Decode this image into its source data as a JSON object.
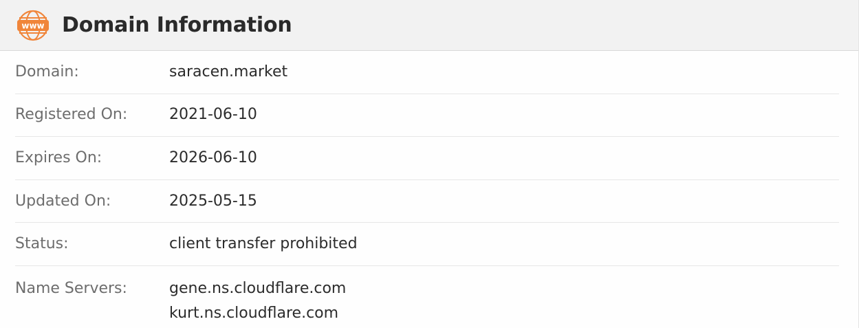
{
  "header": {
    "title": "Domain Information",
    "icon": "www-globe-icon",
    "icon_text": "www",
    "icon_color": "#f0853a"
  },
  "rows": [
    {
      "label": "Domain:",
      "value": "saracen.market"
    },
    {
      "label": "Registered On:",
      "value": "2021-06-10"
    },
    {
      "label": "Expires On:",
      "value": "2026-06-10"
    },
    {
      "label": "Updated On:",
      "value": "2025-05-15"
    },
    {
      "label": "Status:",
      "value": "client transfer prohibited"
    }
  ],
  "name_servers": {
    "label": "Name Servers:",
    "values": [
      "gene.ns.cloudflare.com",
      "kurt.ns.cloudflare.com"
    ]
  },
  "colors": {
    "header_bg": "#f2f2f2",
    "label_text": "#6d6d6d",
    "value_text": "#2c2c2c",
    "accent": "#f0853a"
  }
}
